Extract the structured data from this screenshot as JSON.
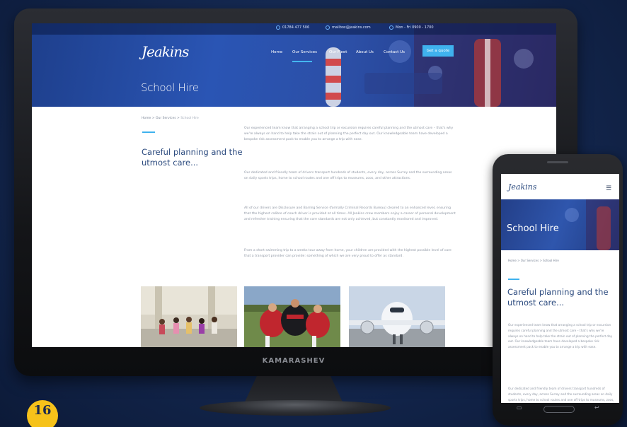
{
  "site": {
    "logo": "Jeakins",
    "topbar": {
      "phone": "01784 477 506",
      "email": "mailbox@jeakins.com",
      "hours": "Mon - Fri 0900 - 1700"
    },
    "nav": {
      "items": [
        "Home",
        "Our Services",
        "Our Fleet",
        "About Us",
        "Contact Us"
      ],
      "active": "Our Services",
      "cta": "Get a quote"
    },
    "hero_title": "School Hire",
    "breadcrumb": {
      "home": "Home",
      "section": "Our Services",
      "current": "School Hire",
      "separator": ">"
    },
    "intro_heading": "Careful planning and the utmost care...",
    "paragraphs": [
      "Our experienced team know that arranging a school trip or excursion requires careful planning and the utmost care – that's why we're always on hand to help take the strain out of planning the perfect day out. Our knowledgeable team have developed a bespoke risk assessment pack to enable you to arrange a trip with ease.",
      "Our dedicated and friendly team of drivers transport hundreds of students, every day, across Surrey and the surrounding areas on daily sports trips, home to school routes and one off trips to museums, zoos, and other attractions.",
      "All of our drivers are Disclosure and Barring Service (formally Criminal Records Bureau) cleared to an enhanced level, ensuring that the highest calibre of coach driver is provided at all times. All Jeakins crew members enjoy a career of personal development and refresher training ensuring that the core standards are not only achieved, but constantly monitored and improved.",
      "From a short swimming trip to a weeks tour away from home, your children are provided with the highest possible level of care that a transport provider can provide: something of which we are very proud to offer as standard."
    ],
    "photos": [
      "children-running-photo",
      "rugby-players-photo",
      "aircraft-photo"
    ]
  },
  "monitor_brand": "KAMARASHEV",
  "page_number": "16",
  "colors": {
    "accent": "#3fb2ee",
    "heading": "#2b4a7e",
    "badge": "#f6c21a"
  }
}
